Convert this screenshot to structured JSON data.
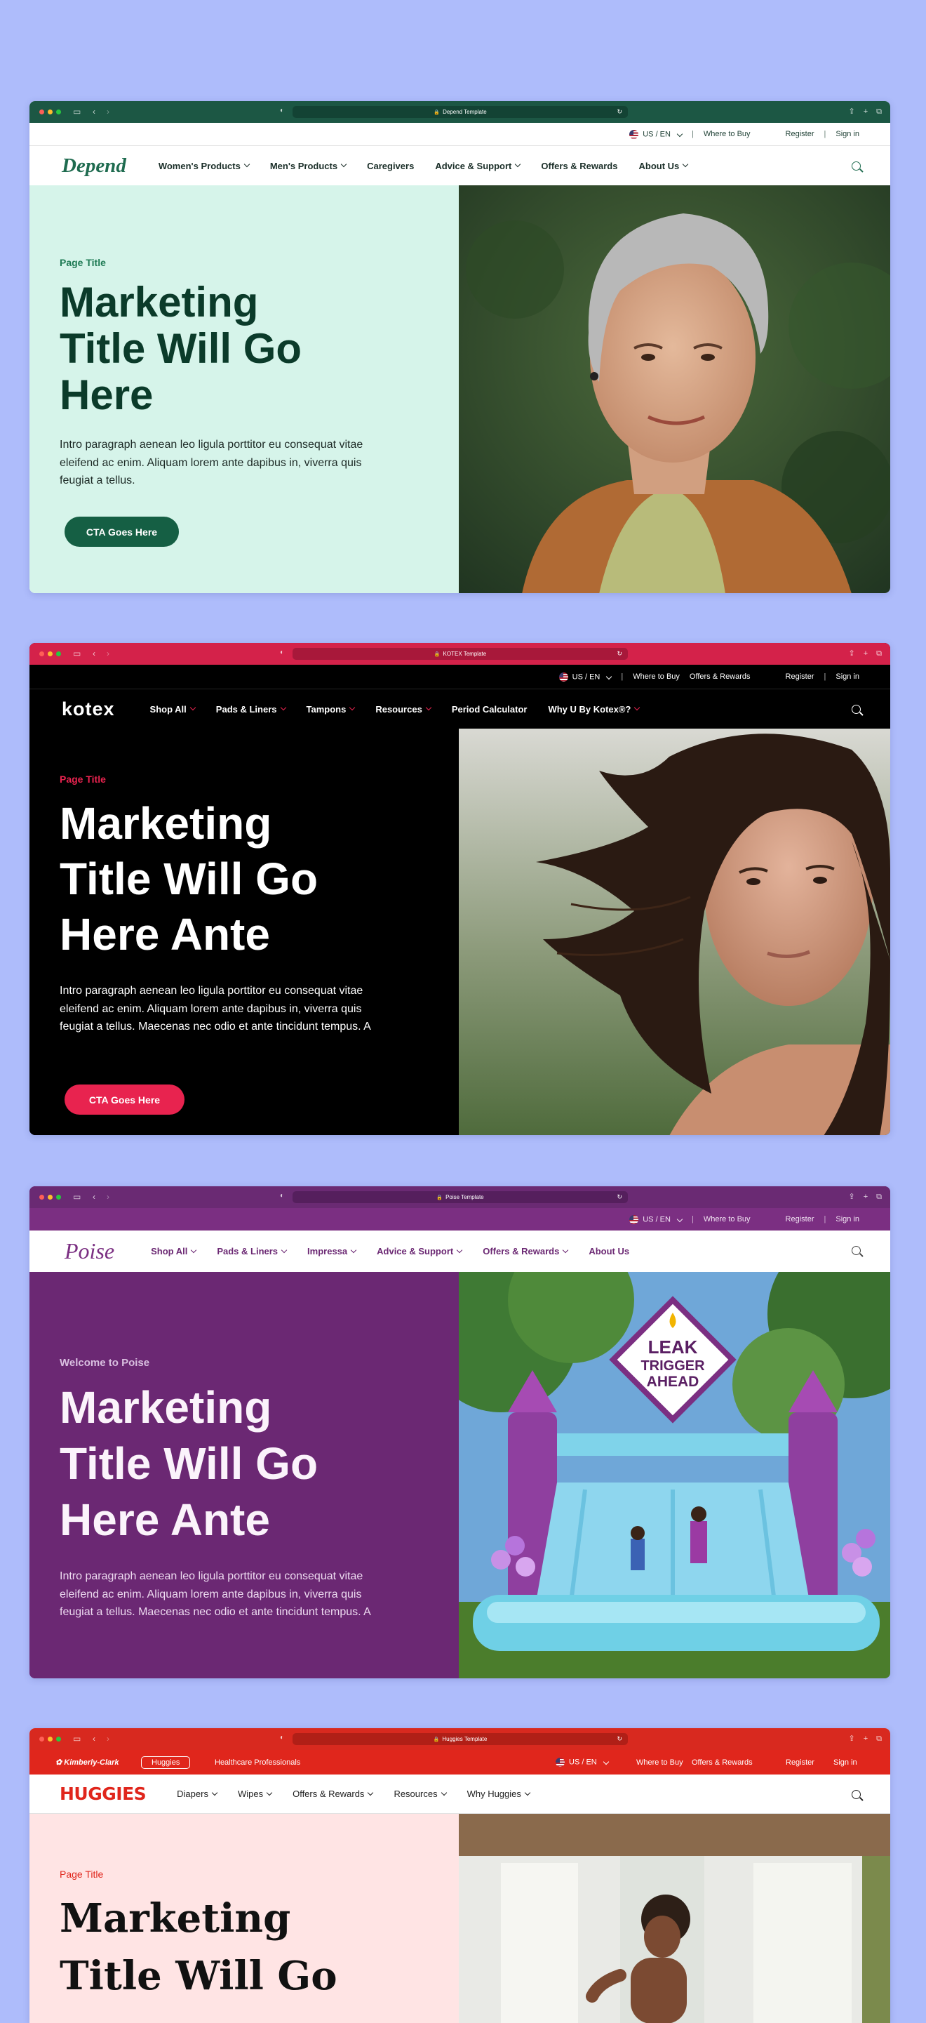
{
  "windows": [
    {
      "id": "depend",
      "url": "Depend Template",
      "utility": {
        "locale": "US / EN",
        "where_to_buy": "Where to Buy",
        "register": "Register",
        "sign_in": "Sign in"
      },
      "logo": "Depend",
      "nav": [
        "Women's Products",
        "Men's Products",
        "Caregivers",
        "Advice & Support",
        "Offers & Rewards",
        "About Us"
      ],
      "eyebrow": "Page Title",
      "title_lines": [
        "Marketing",
        "Title Will Go",
        "Here"
      ],
      "intro": "Intro paragraph aenean leo ligula porttitor eu consequat vitae eleifend ac enim. Aliquam lorem ante dapibus in, viverra quis feugiat a tellus.",
      "cta": "CTA Goes Here",
      "colors": {
        "chrome": "#1c5744",
        "accent": "#155f44",
        "hero_bg": "#d6f4ea",
        "title": "#0b3b2a"
      }
    },
    {
      "id": "kotex",
      "url": "KOTEX Template",
      "utility": {
        "locale": "US / EN",
        "where_to_buy": "Where to Buy",
        "offers": "Offers & Rewards",
        "register": "Register",
        "sign_in": "Sign in"
      },
      "logo": "KOTEX",
      "nav": [
        "Shop All",
        "Pads & Liners",
        "Tampons",
        "Resources",
        "Period Calculator",
        "Why U By Kotex®?"
      ],
      "eyebrow": "Page Title",
      "title_lines": [
        "Marketing",
        "Title Will Go",
        "Here Ante"
      ],
      "intro": "Intro paragraph aenean leo ligula porttitor eu consequat vitae eleifend ac enim. Aliquam lorem ante dapibus in, viverra quis feugiat a tellus. Maecenas nec odio et ante tincidunt tempus. A",
      "cta": "CTA Goes Here",
      "colors": {
        "chrome": "#d4224a",
        "accent": "#e8234f",
        "hero_bg": "#000000",
        "title": "#ffffff"
      }
    },
    {
      "id": "poise",
      "url": "Poise Template",
      "utility": {
        "locale": "US / EN",
        "where_to_buy": "Where to Buy",
        "register": "Register",
        "sign_in": "Sign in"
      },
      "logo": "Poise",
      "nav": [
        "Shop All",
        "Pads & Liners",
        "Impressa",
        "Advice & Support",
        "Offers & Rewards",
        "About Us"
      ],
      "eyebrow": "Welcome to Poise",
      "title_lines": [
        "Marketing",
        "Title Will Go",
        "Here Ante"
      ],
      "intro": "Intro paragraph aenean leo ligula porttitor eu consequat vitae eleifend ac enim. Aliquam lorem ante dapibus in, viverra quis feugiat a tellus. Maecenas nec odio et ante tincidunt tempus. A",
      "sign_text": [
        "LEAK",
        "TRIGGER",
        "AHEAD"
      ],
      "colors": {
        "chrome": "#6a2a73",
        "accent": "#7b2f82",
        "hero_bg": "#6b2873",
        "title": "#ffffff"
      }
    },
    {
      "id": "huggies",
      "url": "Huggies Template",
      "topbar": {
        "kc": "Kimberly-Clark",
        "huggies_tab": "Huggies",
        "pros": "Healthcare Professionals",
        "locale": "US / EN",
        "where_to_buy": "Where to Buy",
        "offers": "Offers & Rewards",
        "register": "Register",
        "sign_in": "Sign in"
      },
      "logo": "HUGGIES",
      "nav": [
        "Diapers",
        "Wipes",
        "Offers & Rewards",
        "Resources",
        "Why Huggies"
      ],
      "eyebrow": "Page Title",
      "title_lines": [
        "Marketing",
        "Title Will Go"
      ],
      "colors": {
        "chrome": "#d8291f",
        "accent": "#e0261c",
        "hero_bg": "#ffe4e4",
        "title": "#111111"
      }
    }
  ]
}
